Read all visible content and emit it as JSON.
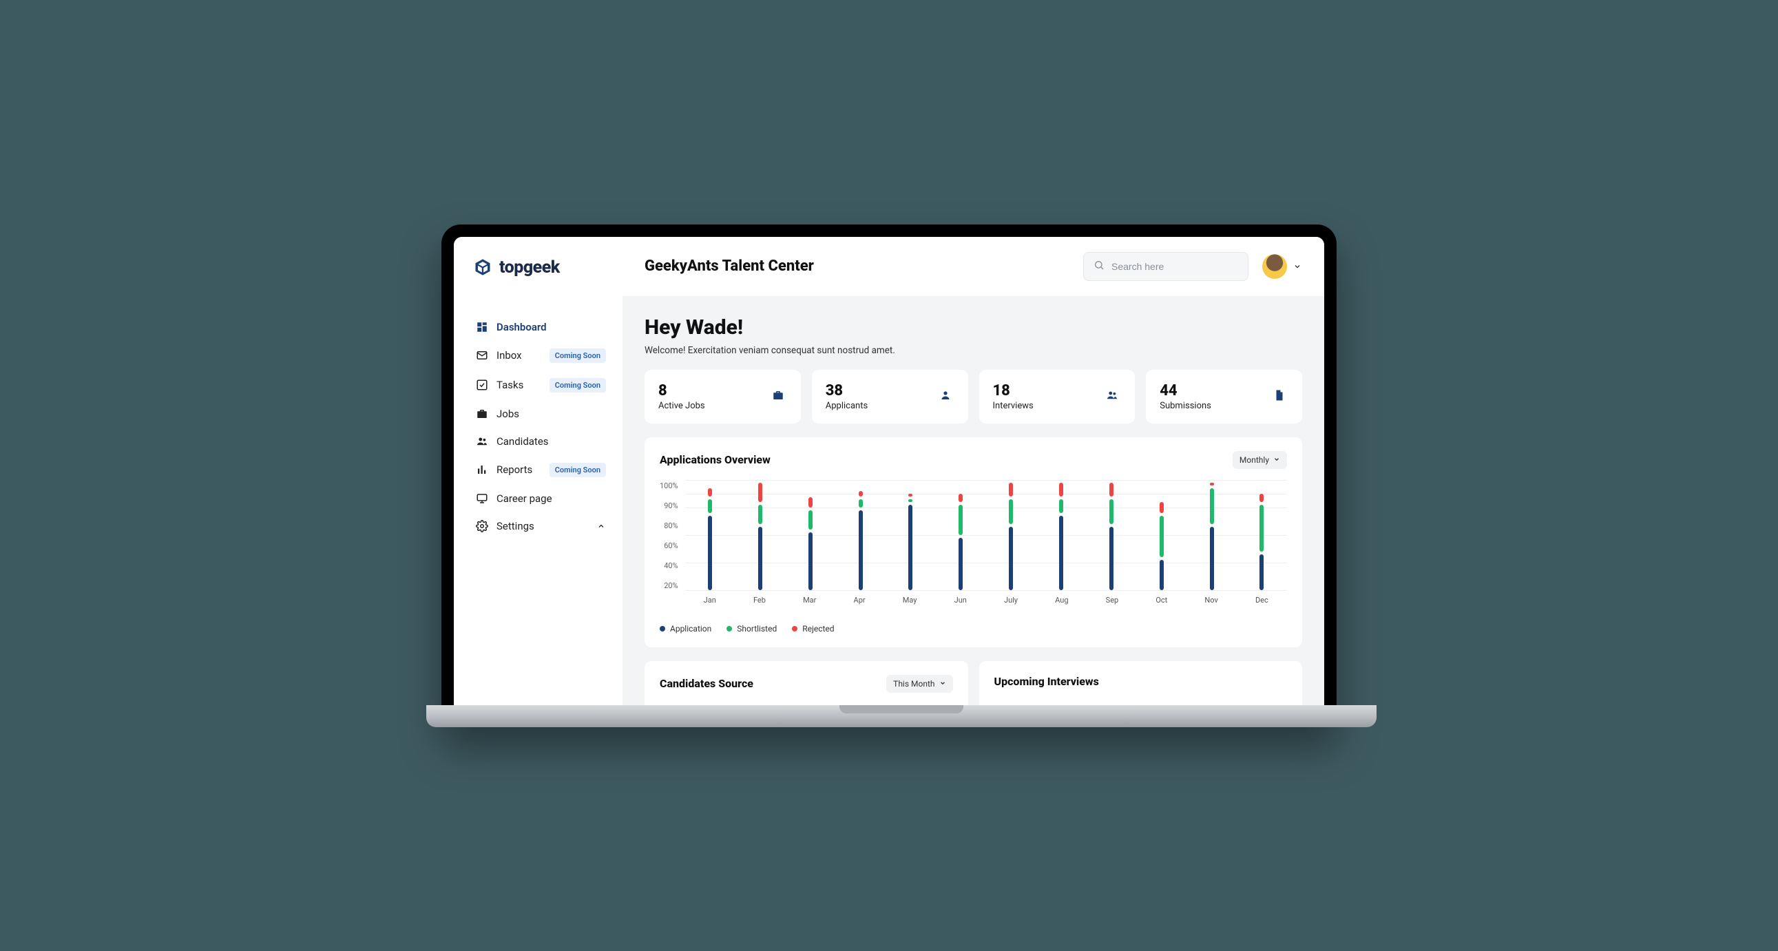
{
  "brand": {
    "name": "topgeek"
  },
  "header": {
    "title": "GeekyAnts Talent Center",
    "search_placeholder": "Search here"
  },
  "sidebar": {
    "items": [
      {
        "icon": "dashboard",
        "label": "Dashboard",
        "active": true,
        "badge": null
      },
      {
        "icon": "mail",
        "label": "Inbox",
        "active": false,
        "badge": "Coming Soon"
      },
      {
        "icon": "check",
        "label": "Tasks",
        "active": false,
        "badge": "Coming Soon"
      },
      {
        "icon": "briefcase",
        "label": "Jobs",
        "active": false,
        "badge": null
      },
      {
        "icon": "people",
        "label": "Candidates",
        "active": false,
        "badge": null
      },
      {
        "icon": "bars",
        "label": "Reports",
        "active": false,
        "badge": "Coming Soon"
      },
      {
        "icon": "monitor",
        "label": "Career page",
        "active": false,
        "badge": null
      },
      {
        "icon": "gear",
        "label": "Settings",
        "active": false,
        "badge": null,
        "expandable": true
      }
    ]
  },
  "greeting": {
    "title": "Hey Wade!",
    "subtitle": "Welcome! Exercitation veniam consequat sunt nostrud amet."
  },
  "stats": [
    {
      "value": "8",
      "label": "Active Jobs",
      "icon": "briefcase"
    },
    {
      "value": "38",
      "label": "Applicants",
      "icon": "person"
    },
    {
      "value": "18",
      "label": "Interviews",
      "icon": "people"
    },
    {
      "value": "44",
      "label": "Submissions",
      "icon": "file"
    }
  ],
  "applications_panel": {
    "title": "Applications Overview",
    "range_label": "Monthly"
  },
  "candidates_panel": {
    "title": "Candidates Source",
    "range_label": "This Month"
  },
  "interviews_panel": {
    "title": "Upcoming Interviews"
  },
  "chart_data": {
    "type": "bar",
    "stacked": true,
    "categories": [
      "Jan",
      "Feb",
      "Mar",
      "Apr",
      "May",
      "Jun",
      "July",
      "Aug",
      "Sep",
      "Oct",
      "Nov",
      "Dec"
    ],
    "series": [
      {
        "name": "Application",
        "color": "#1c3f76",
        "values": [
          70,
          60,
          55,
          75,
          80,
          50,
          60,
          70,
          60,
          30,
          60,
          35
        ]
      },
      {
        "name": "Shortlisted",
        "color": "#1fb96a",
        "values": [
          15,
          20,
          20,
          10,
          5,
          30,
          25,
          15,
          25,
          40,
          35,
          45
        ]
      },
      {
        "name": "Rejected",
        "color": "#ef4444",
        "values": [
          10,
          20,
          12,
          8,
          5,
          10,
          15,
          15,
          15,
          13,
          5,
          10
        ]
      }
    ],
    "ylabel": "",
    "xlabel": "",
    "ylim": [
      20,
      100
    ],
    "yticks": [
      "100%",
      "90%",
      "80%",
      "60%",
      "40%",
      "20%"
    ],
    "legend": [
      "Application",
      "Shortlisted",
      "Rejected"
    ]
  }
}
